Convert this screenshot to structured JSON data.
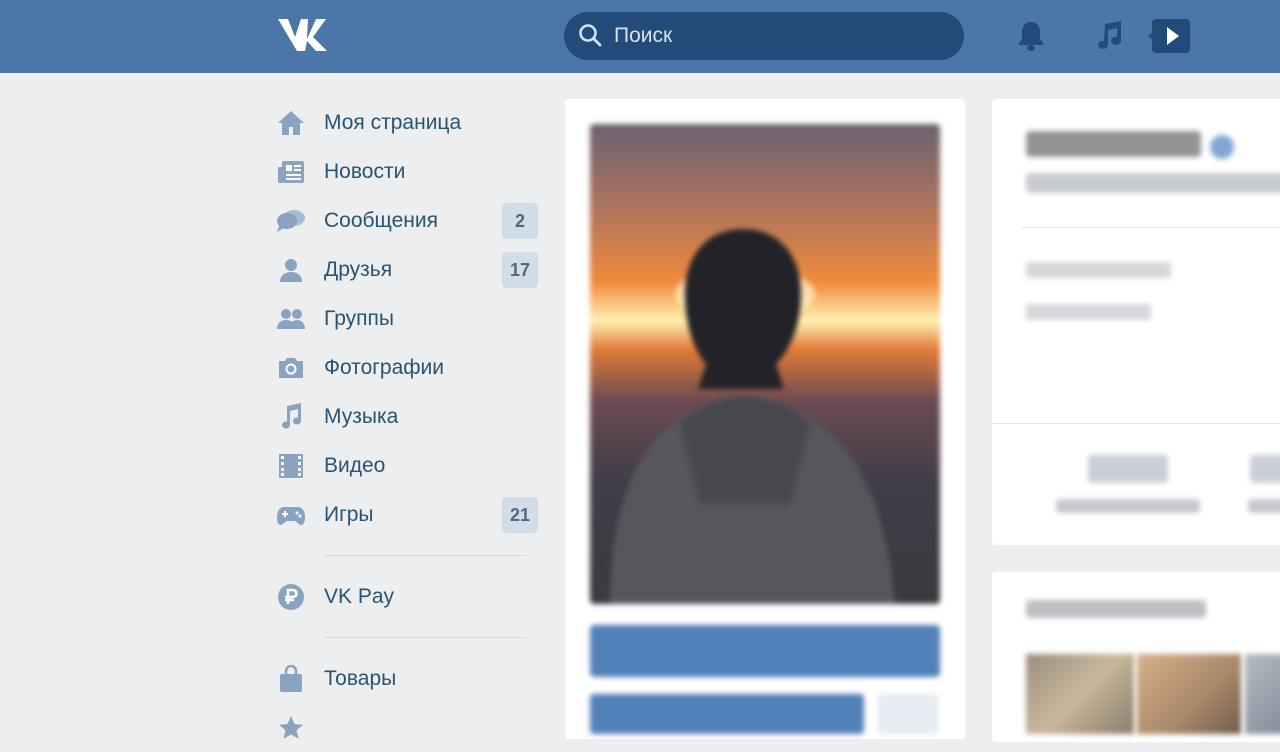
{
  "header": {
    "search_placeholder": "Поиск"
  },
  "sidebar": {
    "items": [
      {
        "label": "Моя страница",
        "icon": "home-icon",
        "badge": ""
      },
      {
        "label": "Новости",
        "icon": "news-icon",
        "badge": ""
      },
      {
        "label": "Сообщения",
        "icon": "messages-icon",
        "badge": "2"
      },
      {
        "label": "Друзья",
        "icon": "friends-icon",
        "badge": "17"
      },
      {
        "label": "Группы",
        "icon": "groups-icon",
        "badge": ""
      },
      {
        "label": "Фотографии",
        "icon": "camera-icon",
        "badge": ""
      },
      {
        "label": "Музыка",
        "icon": "music-note-icon",
        "badge": ""
      },
      {
        "label": "Видео",
        "icon": "film-icon",
        "badge": ""
      },
      {
        "label": "Игры",
        "icon": "gamepad-icon",
        "badge": "21"
      }
    ],
    "vkpay": {
      "label": "VK Pay",
      "icon": "ruble-icon"
    },
    "goods": {
      "label": "Товары",
      "icon": "shopping-bag-icon"
    }
  },
  "colors": {
    "header_bg": "#4a76a8",
    "search_bg": "#224b7a",
    "page_bg": "#edeef0",
    "menu_text": "#285473",
    "badge_bg": "#d3dde8",
    "button_blue": "#5181b8"
  }
}
